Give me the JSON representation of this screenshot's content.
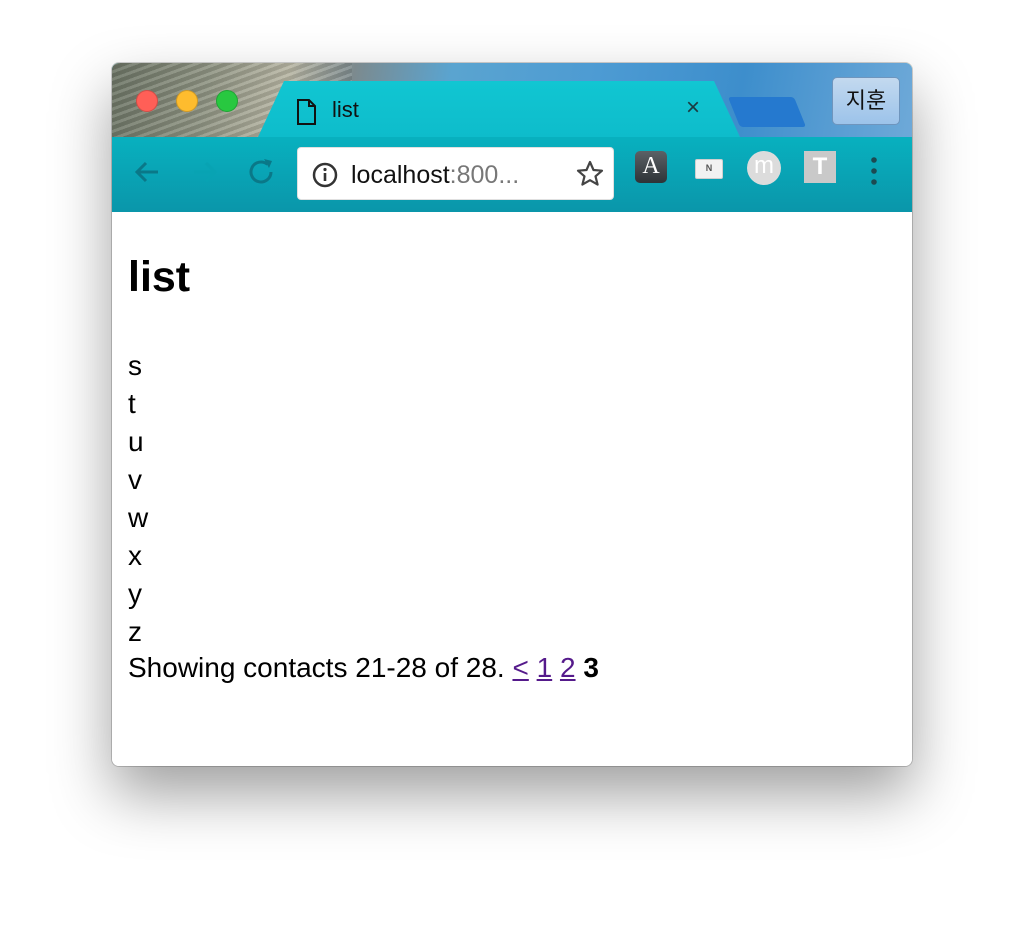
{
  "tab": {
    "title": "list",
    "close_glyph": "×"
  },
  "profile_label": "지훈",
  "address_bar": {
    "host": "localhost",
    "port_truncated": ":800..."
  },
  "extensions": {
    "a_label": "A",
    "n_label": "N",
    "m_label": "m",
    "t_label": "T"
  },
  "page": {
    "heading": "list",
    "contacts": [
      "s",
      "t",
      "u",
      "v",
      "w",
      "x",
      "y",
      "z"
    ],
    "pagination": {
      "summary": "Showing contacts 21-28 of 28.",
      "prev": "<",
      "pages": [
        "1",
        "2"
      ],
      "current": "3"
    }
  },
  "colors": {
    "link_visited": "#551a8b",
    "tab_teal": "#0ebccb",
    "accent_blue": "#2579cf"
  }
}
